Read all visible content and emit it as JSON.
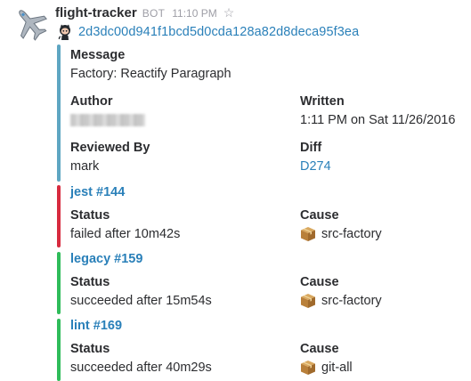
{
  "message": {
    "app_name": "flight-tracker",
    "bot_tag": "BOT",
    "timestamp": "11:10 PM",
    "commit_hash": "2d3dc00d941f1bcd5d0cda128a82d8deca95f3ea",
    "avatar_icon": "airplane-icon",
    "commit_icon": "github-octocat-icon"
  },
  "colors": {
    "link": "#2a80b9",
    "info_bar": "#5ea6c2",
    "failed_bar": "#d72b3f",
    "success_bar": "#2fbc5a",
    "text": "#2c2d30",
    "muted": "#9e9ea6"
  },
  "summary": {
    "message_label": "Message",
    "message_value": "Factory: Reactify Paragraph",
    "author_label": "Author",
    "author_value_redacted": true,
    "written_label": "Written",
    "written_value": "1:11 PM on Sat 11/26/2016",
    "reviewed_label": "Reviewed By",
    "reviewed_value": "mark",
    "diff_label": "Diff",
    "diff_value": "D274"
  },
  "builds": [
    {
      "title": "jest #144",
      "status_label": "Status",
      "status_value": "failed after 10m42s",
      "cause_label": "Cause",
      "cause_value": "src-factory",
      "state": "failed"
    },
    {
      "title": "legacy #159",
      "status_label": "Status",
      "status_value": "succeeded after 15m54s",
      "cause_label": "Cause",
      "cause_value": "src-factory",
      "state": "succeeded"
    },
    {
      "title": "lint #169",
      "status_label": "Status",
      "status_value": "succeeded after 40m29s",
      "cause_label": "Cause",
      "cause_value": "git-all",
      "state": "succeeded"
    }
  ]
}
